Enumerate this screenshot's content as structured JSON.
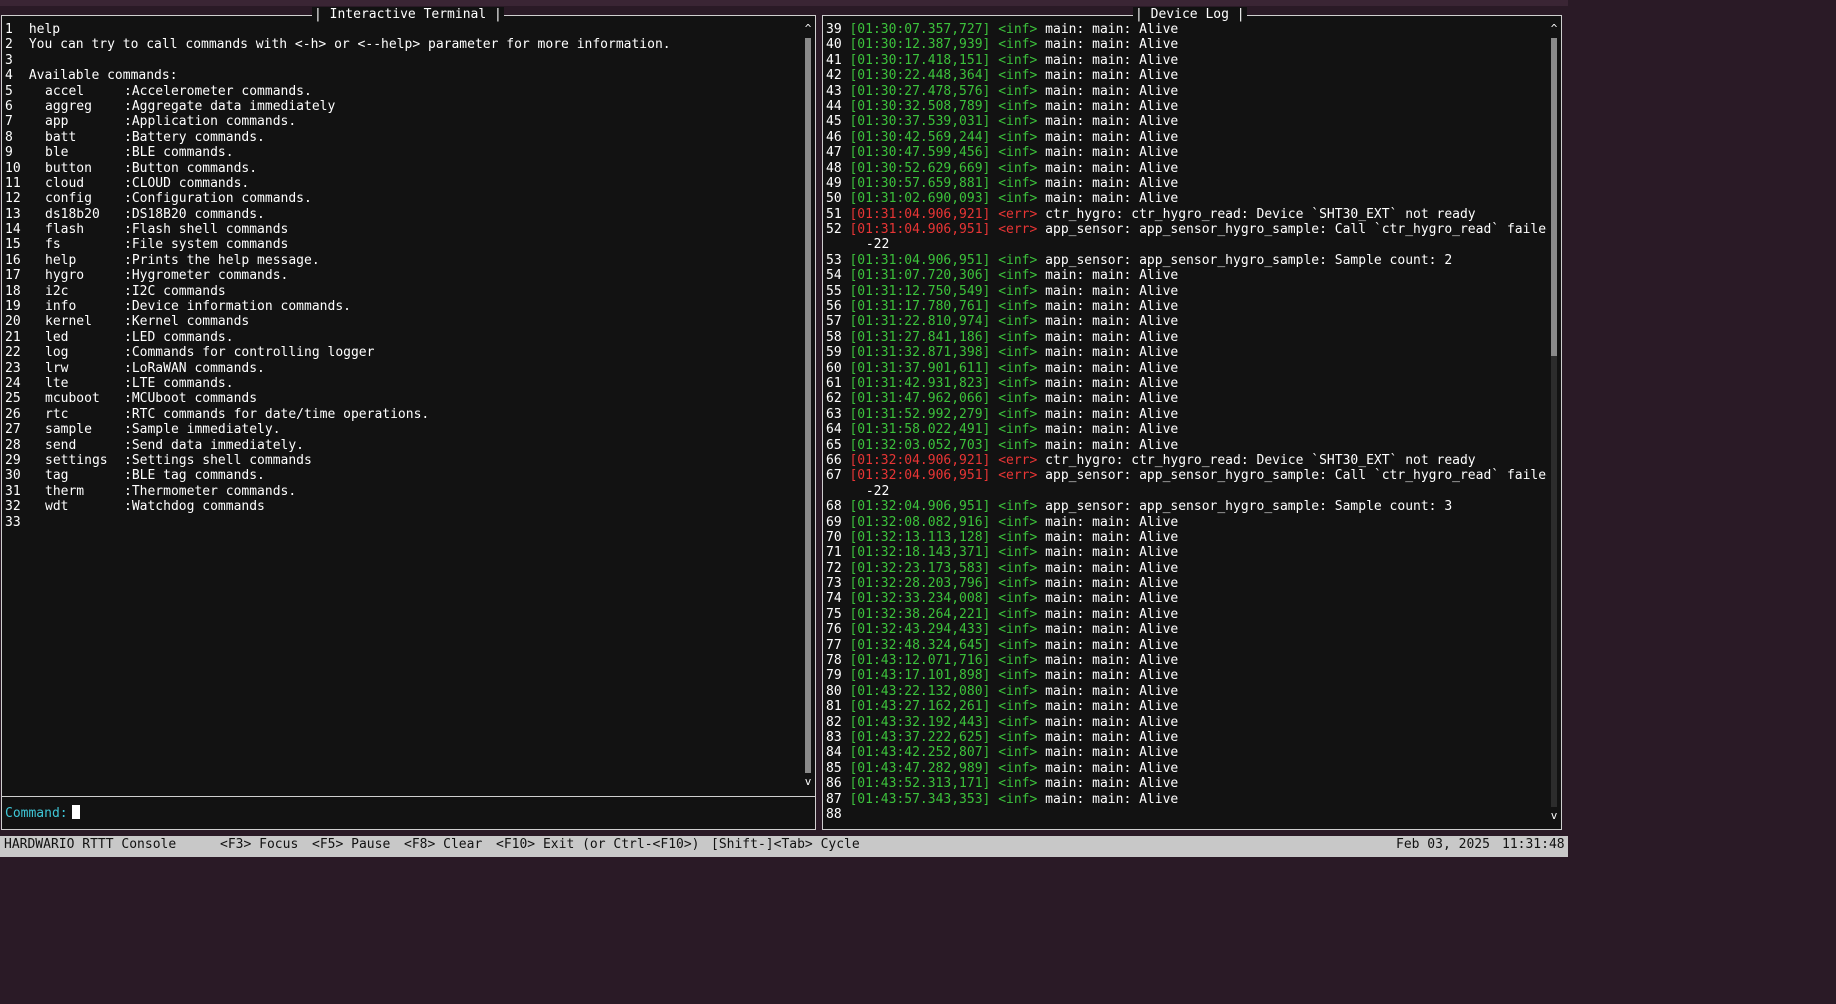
{
  "terminal": {
    "title": "| Interactive Terminal |",
    "lines": [
      {
        "n": "1",
        "text": "help"
      },
      {
        "n": "2",
        "text": "You can try to call commands with <-h> or <--help> parameter for more information."
      },
      {
        "n": "3",
        "text": ""
      },
      {
        "n": "4",
        "text": "Available commands:"
      }
    ],
    "commands": [
      {
        "n": "5",
        "name": "accel",
        "desc": ":Accelerometer commands."
      },
      {
        "n": "6",
        "name": "aggreg",
        "desc": ":Aggregate data immediately"
      },
      {
        "n": "7",
        "name": "app",
        "desc": ":Application commands."
      },
      {
        "n": "8",
        "name": "batt",
        "desc": ":Battery commands."
      },
      {
        "n": "9",
        "name": "ble",
        "desc": ":BLE commands."
      },
      {
        "n": "10",
        "name": "button",
        "desc": ":Button commands."
      },
      {
        "n": "11",
        "name": "cloud",
        "desc": ":CLOUD commands."
      },
      {
        "n": "12",
        "name": "config",
        "desc": ":Configuration commands."
      },
      {
        "n": "13",
        "name": "ds18b20",
        "desc": ":DS18B20 commands."
      },
      {
        "n": "14",
        "name": "flash",
        "desc": ":Flash shell commands"
      },
      {
        "n": "15",
        "name": "fs",
        "desc": ":File system commands"
      },
      {
        "n": "16",
        "name": "help",
        "desc": ":Prints the help message."
      },
      {
        "n": "17",
        "name": "hygro",
        "desc": ":Hygrometer commands."
      },
      {
        "n": "18",
        "name": "i2c",
        "desc": ":I2C commands"
      },
      {
        "n": "19",
        "name": "info",
        "desc": ":Device information commands."
      },
      {
        "n": "20",
        "name": "kernel",
        "desc": ":Kernel commands"
      },
      {
        "n": "21",
        "name": "led",
        "desc": ":LED commands."
      },
      {
        "n": "22",
        "name": "log",
        "desc": ":Commands for controlling logger"
      },
      {
        "n": "23",
        "name": "lrw",
        "desc": ":LoRaWAN commands."
      },
      {
        "n": "24",
        "name": "lte",
        "desc": ":LTE commands."
      },
      {
        "n": "25",
        "name": "mcuboot",
        "desc": ":MCUboot commands"
      },
      {
        "n": "26",
        "name": "rtc",
        "desc": ":RTC commands for date/time operations."
      },
      {
        "n": "27",
        "name": "sample",
        "desc": ":Sample immediately."
      },
      {
        "n": "28",
        "name": "send",
        "desc": ":Send data immediately."
      },
      {
        "n": "29",
        "name": "settings",
        "desc": ":Settings shell commands"
      },
      {
        "n": "30",
        "name": "tag",
        "desc": ":BLE tag commands."
      },
      {
        "n": "31",
        "name": "therm",
        "desc": ":Thermometer commands."
      },
      {
        "n": "32",
        "name": "wdt",
        "desc": ":Watchdog commands"
      }
    ],
    "last_line_number": "33",
    "command_label": "Command:",
    "scroll_up_glyph": "^",
    "scroll_down_glyph": "v"
  },
  "device_log": {
    "title": "| Device Log |",
    "entries": [
      {
        "n": "39",
        "ts": "[01:30:07.357,727]",
        "level": "<inf>",
        "msg": "main: main: Alive",
        "kind": "inf"
      },
      {
        "n": "40",
        "ts": "[01:30:12.387,939]",
        "level": "<inf>",
        "msg": "main: main: Alive",
        "kind": "inf"
      },
      {
        "n": "41",
        "ts": "[01:30:17.418,151]",
        "level": "<inf>",
        "msg": "main: main: Alive",
        "kind": "inf"
      },
      {
        "n": "42",
        "ts": "[01:30:22.448,364]",
        "level": "<inf>",
        "msg": "main: main: Alive",
        "kind": "inf"
      },
      {
        "n": "43",
        "ts": "[01:30:27.478,576]",
        "level": "<inf>",
        "msg": "main: main: Alive",
        "kind": "inf"
      },
      {
        "n": "44",
        "ts": "[01:30:32.508,789]",
        "level": "<inf>",
        "msg": "main: main: Alive",
        "kind": "inf"
      },
      {
        "n": "45",
        "ts": "[01:30:37.539,031]",
        "level": "<inf>",
        "msg": "main: main: Alive",
        "kind": "inf"
      },
      {
        "n": "46",
        "ts": "[01:30:42.569,244]",
        "level": "<inf>",
        "msg": "main: main: Alive",
        "kind": "inf"
      },
      {
        "n": "47",
        "ts": "[01:30:47.599,456]",
        "level": "<inf>",
        "msg": "main: main: Alive",
        "kind": "inf"
      },
      {
        "n": "48",
        "ts": "[01:30:52.629,669]",
        "level": "<inf>",
        "msg": "main: main: Alive",
        "kind": "inf"
      },
      {
        "n": "49",
        "ts": "[01:30:57.659,881]",
        "level": "<inf>",
        "msg": "main: main: Alive",
        "kind": "inf"
      },
      {
        "n": "50",
        "ts": "[01:31:02.690,093]",
        "level": "<inf>",
        "msg": "main: main: Alive",
        "kind": "inf"
      },
      {
        "n": "51",
        "ts": "[01:31:04.906,921]",
        "level": "<err>",
        "msg": "ctr_hygro: ctr_hygro_read: Device `SHT30_EXT` not ready",
        "kind": "err"
      },
      {
        "n": "52",
        "ts": "[01:31:04.906,951]",
        "level": "<err>",
        "msg": "app_sensor: app_sensor_hygro_sample: Call `ctr_hygro_read` failed:",
        "kind": "err"
      },
      {
        "n": "",
        "ts": "",
        "level": "",
        "msg": " -22",
        "kind": "cont"
      },
      {
        "n": "53",
        "ts": "[01:31:04.906,951]",
        "level": "<inf>",
        "msg": "app_sensor: app_sensor_hygro_sample: Sample count: 2",
        "kind": "inf"
      },
      {
        "n": "54",
        "ts": "[01:31:07.720,306]",
        "level": "<inf>",
        "msg": "main: main: Alive",
        "kind": "inf"
      },
      {
        "n": "55",
        "ts": "[01:31:12.750,549]",
        "level": "<inf>",
        "msg": "main: main: Alive",
        "kind": "inf"
      },
      {
        "n": "56",
        "ts": "[01:31:17.780,761]",
        "level": "<inf>",
        "msg": "main: main: Alive",
        "kind": "inf"
      },
      {
        "n": "57",
        "ts": "[01:31:22.810,974]",
        "level": "<inf>",
        "msg": "main: main: Alive",
        "kind": "inf"
      },
      {
        "n": "58",
        "ts": "[01:31:27.841,186]",
        "level": "<inf>",
        "msg": "main: main: Alive",
        "kind": "inf"
      },
      {
        "n": "59",
        "ts": "[01:31:32.871,398]",
        "level": "<inf>",
        "msg": "main: main: Alive",
        "kind": "inf"
      },
      {
        "n": "60",
        "ts": "[01:31:37.901,611]",
        "level": "<inf>",
        "msg": "main: main: Alive",
        "kind": "inf"
      },
      {
        "n": "61",
        "ts": "[01:31:42.931,823]",
        "level": "<inf>",
        "msg": "main: main: Alive",
        "kind": "inf"
      },
      {
        "n": "62",
        "ts": "[01:31:47.962,066]",
        "level": "<inf>",
        "msg": "main: main: Alive",
        "kind": "inf"
      },
      {
        "n": "63",
        "ts": "[01:31:52.992,279]",
        "level": "<inf>",
        "msg": "main: main: Alive",
        "kind": "inf"
      },
      {
        "n": "64",
        "ts": "[01:31:58.022,491]",
        "level": "<inf>",
        "msg": "main: main: Alive",
        "kind": "inf"
      },
      {
        "n": "65",
        "ts": "[01:32:03.052,703]",
        "level": "<inf>",
        "msg": "main: main: Alive",
        "kind": "inf"
      },
      {
        "n": "66",
        "ts": "[01:32:04.906,921]",
        "level": "<err>",
        "msg": "ctr_hygro: ctr_hygro_read: Device `SHT30_EXT` not ready",
        "kind": "err"
      },
      {
        "n": "67",
        "ts": "[01:32:04.906,951]",
        "level": "<err>",
        "msg": "app_sensor: app_sensor_hygro_sample: Call `ctr_hygro_read` failed:",
        "kind": "err"
      },
      {
        "n": "",
        "ts": "",
        "level": "",
        "msg": " -22",
        "kind": "cont"
      },
      {
        "n": "68",
        "ts": "[01:32:04.906,951]",
        "level": "<inf>",
        "msg": "app_sensor: app_sensor_hygro_sample: Sample count: 3",
        "kind": "inf"
      },
      {
        "n": "69",
        "ts": "[01:32:08.082,916]",
        "level": "<inf>",
        "msg": "main: main: Alive",
        "kind": "inf"
      },
      {
        "n": "70",
        "ts": "[01:32:13.113,128]",
        "level": "<inf>",
        "msg": "main: main: Alive",
        "kind": "inf"
      },
      {
        "n": "71",
        "ts": "[01:32:18.143,371]",
        "level": "<inf>",
        "msg": "main: main: Alive",
        "kind": "inf"
      },
      {
        "n": "72",
        "ts": "[01:32:23.173,583]",
        "level": "<inf>",
        "msg": "main: main: Alive",
        "kind": "inf"
      },
      {
        "n": "73",
        "ts": "[01:32:28.203,796]",
        "level": "<inf>",
        "msg": "main: main: Alive",
        "kind": "inf"
      },
      {
        "n": "74",
        "ts": "[01:32:33.234,008]",
        "level": "<inf>",
        "msg": "main: main: Alive",
        "kind": "inf"
      },
      {
        "n": "75",
        "ts": "[01:32:38.264,221]",
        "level": "<inf>",
        "msg": "main: main: Alive",
        "kind": "inf"
      },
      {
        "n": "76",
        "ts": "[01:32:43.294,433]",
        "level": "<inf>",
        "msg": "main: main: Alive",
        "kind": "inf"
      },
      {
        "n": "77",
        "ts": "[01:32:48.324,645]",
        "level": "<inf>",
        "msg": "main: main: Alive",
        "kind": "inf"
      },
      {
        "n": "78",
        "ts": "[01:43:12.071,716]",
        "level": "<inf>",
        "msg": "main: main: Alive",
        "kind": "inf"
      },
      {
        "n": "79",
        "ts": "[01:43:17.101,898]",
        "level": "<inf>",
        "msg": "main: main: Alive",
        "kind": "inf"
      },
      {
        "n": "80",
        "ts": "[01:43:22.132,080]",
        "level": "<inf>",
        "msg": "main: main: Alive",
        "kind": "inf"
      },
      {
        "n": "81",
        "ts": "[01:43:27.162,261]",
        "level": "<inf>",
        "msg": "main: main: Alive",
        "kind": "inf"
      },
      {
        "n": "82",
        "ts": "[01:43:32.192,443]",
        "level": "<inf>",
        "msg": "main: main: Alive",
        "kind": "inf"
      },
      {
        "n": "83",
        "ts": "[01:43:37.222,625]",
        "level": "<inf>",
        "msg": "main: main: Alive",
        "kind": "inf"
      },
      {
        "n": "84",
        "ts": "[01:43:42.252,807]",
        "level": "<inf>",
        "msg": "main: main: Alive",
        "kind": "inf"
      },
      {
        "n": "85",
        "ts": "[01:43:47.282,989]",
        "level": "<inf>",
        "msg": "main: main: Alive",
        "kind": "inf"
      },
      {
        "n": "86",
        "ts": "[01:43:52.313,171]",
        "level": "<inf>",
        "msg": "main: main: Alive",
        "kind": "inf"
      },
      {
        "n": "87",
        "ts": "[01:43:57.343,353]",
        "level": "<inf>",
        "msg": "main: main: Alive",
        "kind": "inf"
      }
    ],
    "last_line_number": "88",
    "scroll_up_glyph": "^",
    "scroll_down_glyph": "v"
  },
  "status_bar": {
    "app_name": "HARDWARIO RTTT Console",
    "keys": [
      {
        "key": "<F3>",
        "label": "Focus"
      },
      {
        "key": "<F5>",
        "label": "Pause"
      },
      {
        "key": "<F8>",
        "label": "Clear"
      },
      {
        "key": "<F10>",
        "label": "Exit (or Ctrl-<F10>)"
      },
      {
        "key": "[Shift-]<Tab>",
        "label": "Cycle"
      }
    ],
    "date": "Feb 03, 2025",
    "time": "11:31:48"
  },
  "colors": {
    "info": "#3cc23c",
    "error": "#e83535",
    "prompt": "#3fc6d6",
    "panel_bg": "#121212",
    "status_bg": "#c8c8c8"
  }
}
